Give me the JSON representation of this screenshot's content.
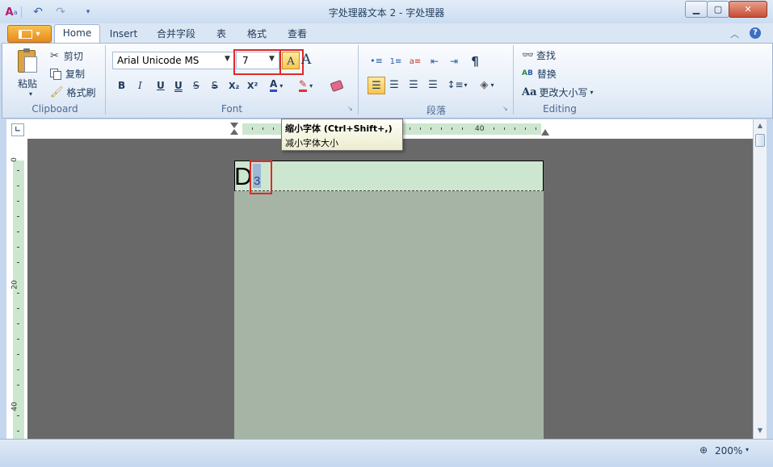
{
  "window": {
    "title": "字处理器文本 2 - 字处理器",
    "controls": {
      "minimize": "▁",
      "maximize": "▢",
      "close": "✕"
    }
  },
  "quick_access": {
    "icons": [
      "app-icon",
      "undo-icon",
      "redo-icon",
      "customize-icon"
    ]
  },
  "tabs": [
    "Home",
    "Insert",
    "合并字段",
    "表",
    "格式",
    "查看"
  ],
  "clipboard": {
    "paste": "粘贴",
    "cut": "剪切",
    "copy": "复制",
    "format_painter": "格式刷",
    "group_label": "Clipboard"
  },
  "font": {
    "font_name": "Arial Unicode MS",
    "font_size": "7",
    "format_buttons": [
      "B",
      "I",
      "U",
      "U",
      "S",
      "S",
      "X₂",
      "X²"
    ],
    "group_label": "Font"
  },
  "paragraph": {
    "group_label": "段落",
    "pilcrow": "¶"
  },
  "editing": {
    "find": "查找",
    "replace": "替换",
    "change_case": "更改大小写",
    "group_label": "Editing"
  },
  "tooltip": {
    "title": "缩小字体 (Ctrl+Shift+,)",
    "description": "减小字体大小"
  },
  "ruler": {
    "horizontal_labels": [
      "40"
    ],
    "vertical_labels": [
      "0",
      "20",
      "40"
    ]
  },
  "document": {
    "text_large": "D",
    "text_small": "3"
  },
  "status": {
    "zoom": "200%"
  },
  "colors": {
    "highlight_box": "#e0292b",
    "header_band": "#cde6d0",
    "page": "#a6b4a5",
    "workspace": "#696969"
  }
}
